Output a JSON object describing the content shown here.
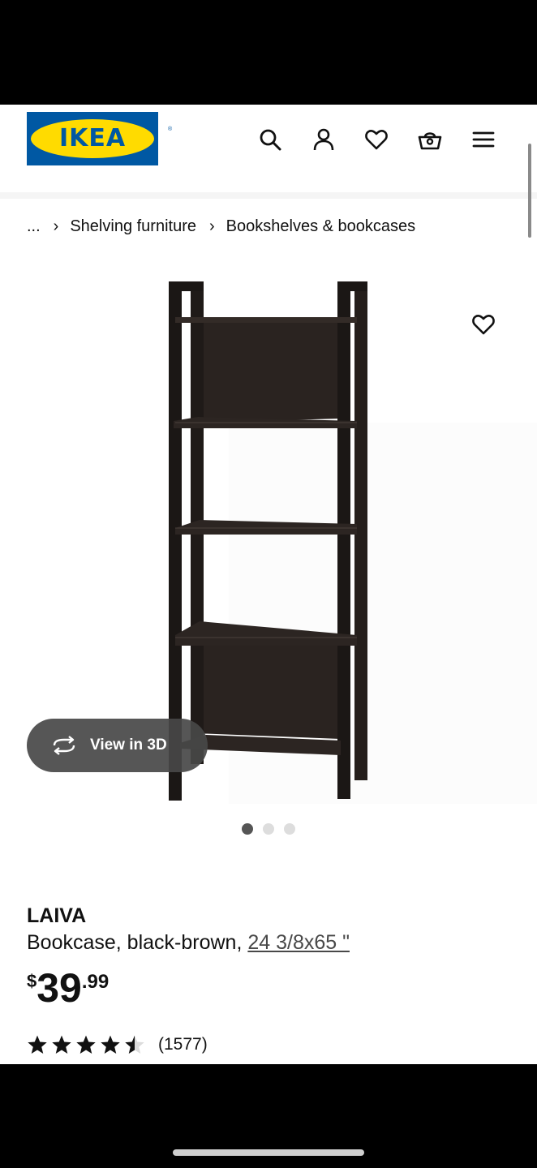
{
  "header": {
    "logo_text": "IKEA",
    "logo_reg": "®",
    "icons": [
      "search-icon",
      "user-icon",
      "heart-icon",
      "basket-icon",
      "menu-icon"
    ],
    "colors": {
      "logo_blue": "#0058a3",
      "logo_yellow": "#ffdb00"
    }
  },
  "breadcrumb": {
    "items": [
      "...",
      "Shelving furniture",
      "Bookshelves & bookcases"
    ],
    "separator": "›"
  },
  "gallery": {
    "view3d_label": "View in 3D",
    "dots_total": 3,
    "active_dot": 1
  },
  "product": {
    "name": "LAIVA",
    "description": "Bookcase, black-brown,",
    "dimensions": "24 3/8x65 \"",
    "price": {
      "currency": "$",
      "integer": "39",
      "decimal": ".99"
    },
    "rating": {
      "stars": 4.5,
      "max": 5,
      "count": "(1577)"
    }
  }
}
